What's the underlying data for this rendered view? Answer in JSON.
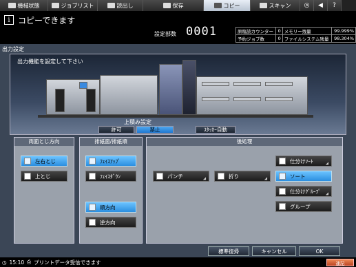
{
  "tabs": [
    {
      "label": "機械状態",
      "icon": "machine-status-icon"
    },
    {
      "label": "ジョブリスト",
      "icon": "job-list-icon"
    },
    {
      "label": "読出し",
      "icon": "recall-icon"
    },
    {
      "label": "保存",
      "icon": "save-icon"
    },
    {
      "label": "コピー",
      "icon": "copy-icon",
      "active": true
    },
    {
      "label": "スキャン",
      "icon": "scan-icon"
    }
  ],
  "header": {
    "status": "コピーできます",
    "copies_label": "設定部数",
    "copies_value": "0001"
  },
  "info": [
    {
      "label": "原稿読カウンター",
      "value": "0",
      "label2": "メモリー残量",
      "value2": "99.999%"
    },
    {
      "label": "予約ジョブ数",
      "value": "0",
      "label2": "ファイルシステム残量",
      "value2": "98.304%"
    }
  ],
  "main": {
    "title": "出力設定",
    "instruction": "出力機能を設定して下さい"
  },
  "stack": {
    "label": "上積み設定",
    "allow": "許可",
    "forbid": "禁止",
    "stacker_auto": "ｽﾀｯｶｰ自動"
  },
  "duplex": {
    "head": "両面とじ方向",
    "left": "左右とじ",
    "top": "上とじ"
  },
  "discharge": {
    "head": "排紙面/排紙順",
    "face_up": "ﾌｪｲｽｱｯﾌﾟ",
    "face_down": "ﾌｪｲｽﾀﾞｳﾝ",
    "normal": "順方向",
    "reverse": "逆方向"
  },
  "post": {
    "head": "後処理",
    "punch": "パンチ",
    "fold": "折り",
    "sort_split": "仕分けｿｰﾄ",
    "sort": "ソート",
    "group_split": "仕分けｸﾞﾙｰﾌﾟ",
    "group": "グループ"
  },
  "footer": {
    "restore": "標準復帰",
    "cancel": "キャンセル",
    "ok": "OK"
  },
  "status_bar": {
    "time": "15:10",
    "message": "プリントデータ受信できます",
    "badge": "連記"
  },
  "colors": {
    "accent": "#2b8ee0",
    "panel": "#9aa1ab",
    "background": "#3b4656"
  }
}
